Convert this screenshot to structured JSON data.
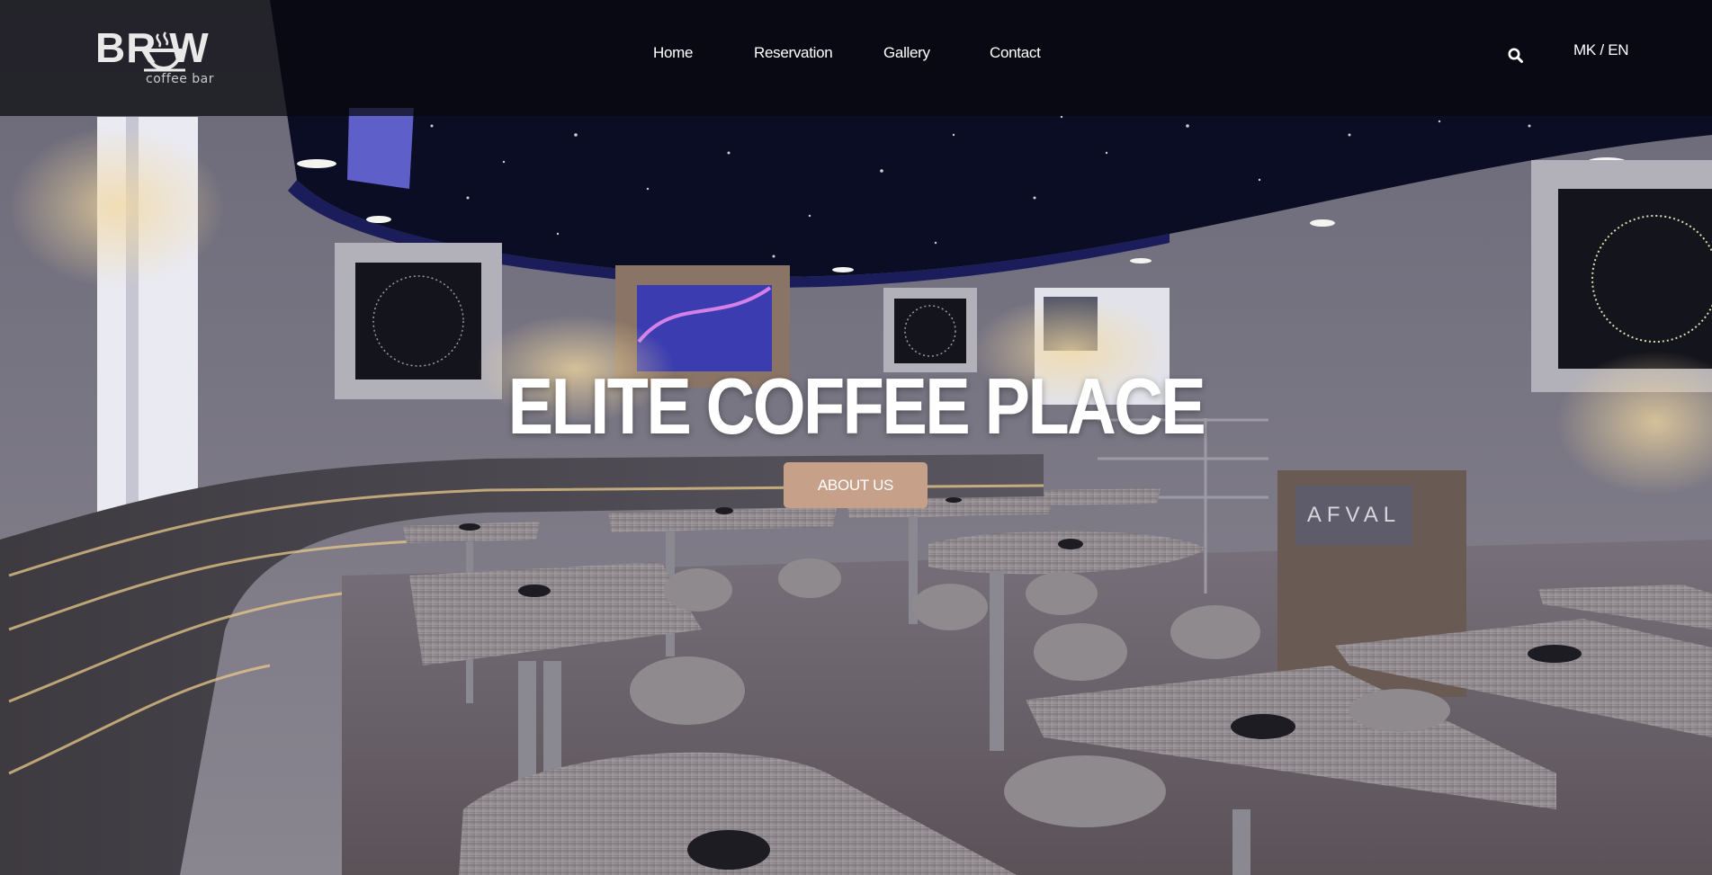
{
  "brand": {
    "logo_word": "BR W",
    "logo_sub": "coffee bar"
  },
  "nav": {
    "items": [
      "Home",
      "Reservation",
      "Gallery",
      "Contact"
    ]
  },
  "header": {
    "search_icon": "search-icon",
    "language_mk": "MK",
    "language_separator": "/",
    "language_en": "EN"
  },
  "hero": {
    "title": "ELITE COFFEE PLACE",
    "button_label": "ABOUT US",
    "button_color": "#c7a08a",
    "background_image": "cafe-interior-photo"
  },
  "scene": {
    "sign_text": "AFVAL"
  }
}
